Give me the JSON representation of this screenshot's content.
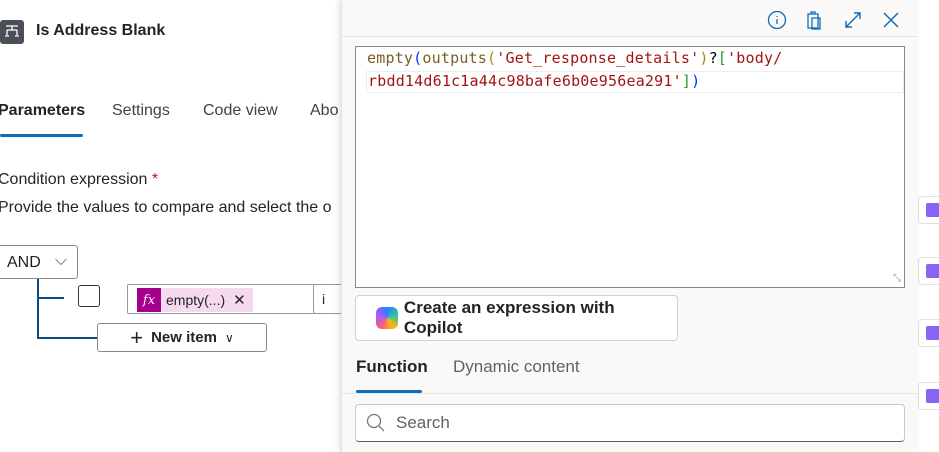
{
  "node": {
    "title": "Is Address Blank",
    "icon": "condition-icon"
  },
  "tabs": [
    {
      "label": "Parameters",
      "active": true
    },
    {
      "label": "Settings"
    },
    {
      "label": "Code view"
    },
    {
      "label": "Abo"
    }
  ],
  "condition": {
    "label": "Condition expression",
    "required_mark": "*",
    "description": "Provide the values to compare and select the o",
    "group_operator": "AND",
    "token_label": "empty(...)",
    "token_prefix": "fx",
    "operator_partial": "i",
    "new_item_label": "New item"
  },
  "expression_panel": {
    "code_line1": {
      "fn1": "empty",
      "p1": "(",
      "fn2": "outputs",
      "p2": "(",
      "s1": "'Get_response_details'",
      "p3": ")",
      "q": "?",
      "b1": "[",
      "s2": "'body/"
    },
    "code_line2": {
      "s3": "rbdd14d61c1a44c98bafe6b0e956ea291'",
      "b2": "]",
      "p4": ")"
    },
    "copilot_button": "Create an expression with Copilot",
    "tabs": [
      {
        "label": "Function",
        "active": true
      },
      {
        "label": "Dynamic content"
      }
    ],
    "search_placeholder": "Search",
    "accent": "#0f6cbd"
  }
}
